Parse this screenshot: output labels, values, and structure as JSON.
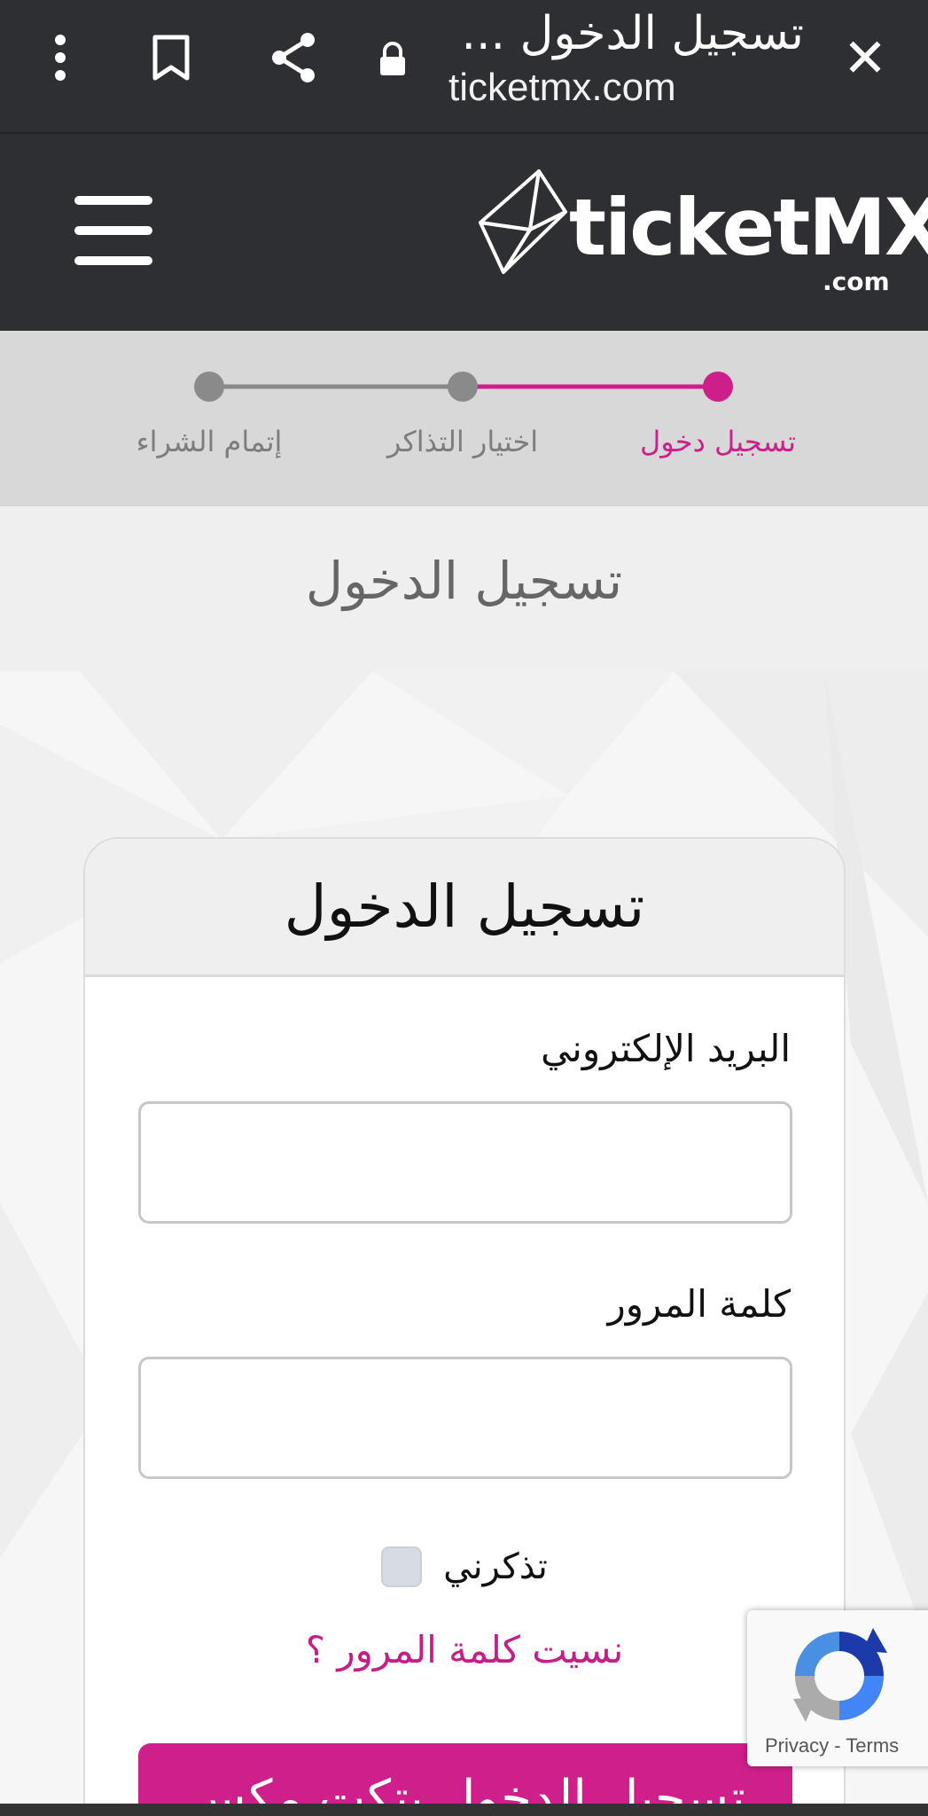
{
  "browser": {
    "tab_title": "تسجيل الدخول ...",
    "url": "ticketmx.com",
    "icons": [
      "close-icon",
      "lock-icon",
      "share-icon",
      "bookmark-icon",
      "more-vert-icon"
    ]
  },
  "header": {
    "logo_text": "ticketMX",
    "logo_suffix": ".com",
    "menu_icon": "hamburger-menu-icon"
  },
  "steps": {
    "items": [
      {
        "label": "تسجيل دخول",
        "state": "active"
      },
      {
        "label": "اختيار التذاكر",
        "state": "pending"
      },
      {
        "label": "إتمام الشراء",
        "state": "pending"
      }
    ],
    "active_color": "#cc1f8a",
    "inactive_color": "#8a8a8a"
  },
  "page": {
    "title": "تسجيل الدخول"
  },
  "login": {
    "card_title": "تسجيل الدخول",
    "email_label": "البريد الإلكتروني",
    "email_value": "",
    "password_label": "كلمة المرور",
    "password_value": "",
    "remember_label": "تذكرني",
    "remember_checked": false,
    "forgot_link": "نسيت كلمة المرور ؟",
    "submit_label": "تسجيل الدخول بتكت مكس"
  },
  "recaptcha": {
    "privacy": "Privacy",
    "separator": "-",
    "terms": "Terms"
  },
  "colors": {
    "brand": "#cf1f8a",
    "dark_bar": "#2e2f32"
  }
}
